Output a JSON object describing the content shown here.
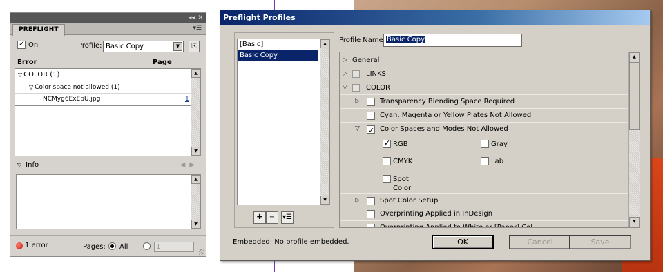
{
  "preflight_panel": {
    "tab": "PREFLIGHT",
    "on_label": "On",
    "on_checked": true,
    "profile_label": "Profile:",
    "profile_value": "Basic Copy",
    "col_error": "Error",
    "col_page": "Page",
    "errors": [
      {
        "label": "COLOR (1)",
        "level": 0,
        "expanded": true
      },
      {
        "label": "Color space not allowed (1)",
        "level": 1,
        "expanded": true
      },
      {
        "label": "NCMyg6ExEpU.jpg",
        "level": 2,
        "page": "1"
      }
    ],
    "info_label": "Info",
    "status_text": "1 error",
    "status_color": "#d42010",
    "pages_label": "Pages:",
    "pages_all_label": "All",
    "pages_range_value": "1"
  },
  "dialog": {
    "title": "Preflight Profiles",
    "profiles": [
      "[Basic]",
      "Basic Copy"
    ],
    "selected_profile": "Basic Copy",
    "profile_name_label": "Profile Name:",
    "profile_name_value": "Basic Copy",
    "tree": {
      "general": "General",
      "links": "LINKS",
      "color": "COLOR",
      "transparency": "Transparency Blending Space Required",
      "cmy_plates": "Cyan, Magenta or Yellow Plates Not Allowed",
      "color_spaces": "Color Spaces and Modes Not Allowed",
      "rgb": "RGB",
      "gray": "Gray",
      "cmyk": "CMYK",
      "lab": "Lab",
      "spot_color": "Spot Color",
      "spot_color_setup": "Spot Color Setup",
      "overprinting": "Overprinting Applied in InDesign",
      "overprinting_white": "Overprinting Applied to White or [Paper] Col"
    },
    "embedded_text": "Embedded:  No profile embedded.",
    "ok_label": "OK",
    "cancel_label": "Cancel",
    "save_label": "Save",
    "accent_color": "#0a246a"
  }
}
